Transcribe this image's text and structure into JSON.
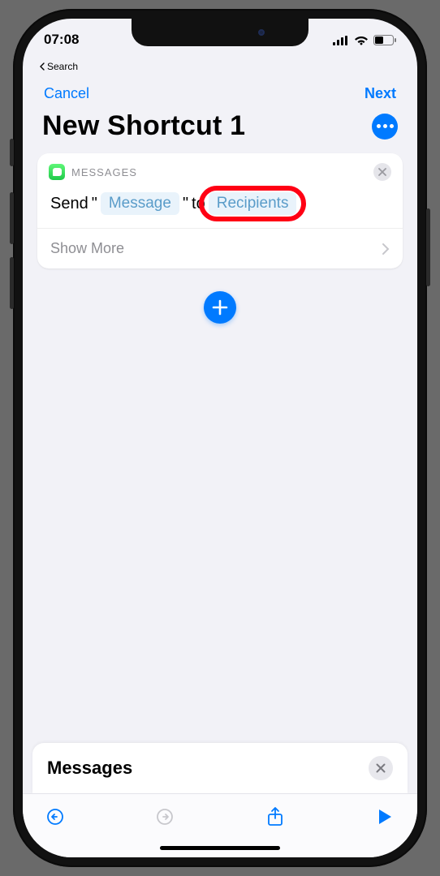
{
  "status": {
    "time": "07:08",
    "back": "Search"
  },
  "nav": {
    "cancel": "Cancel",
    "next": "Next"
  },
  "title": "New Shortcut 1",
  "action": {
    "app": "MESSAGES",
    "verb": "Send",
    "q1": "\"",
    "param1": "Message",
    "q2": "\"",
    "to": "to",
    "param2": "Recipients",
    "more": "Show More"
  },
  "panel": {
    "title": "Messages"
  }
}
